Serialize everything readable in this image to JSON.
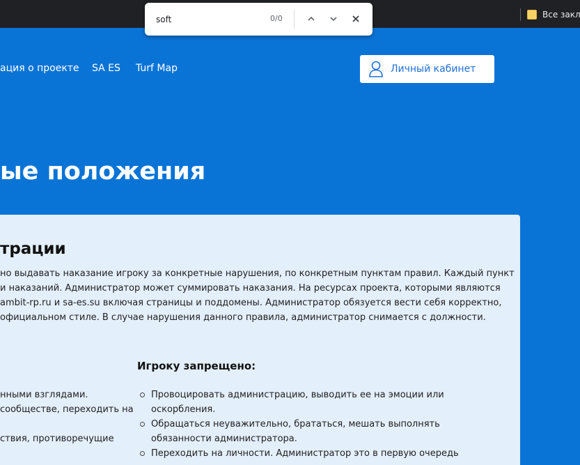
{
  "browser": {
    "bookmarks_label": "Все закла",
    "find": {
      "query": "soft",
      "count": "0/0"
    }
  },
  "nav": {
    "items": [
      "ация о проекте",
      "SA ES",
      "Turf Map"
    ],
    "cabinet_label": "Личный кабинет"
  },
  "hero": {
    "title": "ые положения"
  },
  "section": {
    "title": "трации",
    "intro_lines": [
      "но выдавать наказание игроку за конкретные нарушения, по конкретным пунктам правил. Каждый пункт",
      "и наказаний. Администратор может суммировать наказания. На ресурсах проекта, которыми являются",
      "ambit-rp.ru и sa-es.su включая страницы и поддомены. Администратор обязуется вести себя корректно,",
      "официальном стиле. В случае нарушения данного правила, администратор снимается с должности."
    ],
    "left_lines": [
      "нными взглядами.",
      "сообществе, переходить на",
      "",
      "ствия, противоречущие"
    ],
    "player_forbidden_title": "Игроку запрещено:",
    "rules": [
      [
        "Провоцировать администрацию, выводить ее на эмоции или",
        "оскорбления."
      ],
      [
        "Обращаться неуважительно, брататься, мешать выполнять",
        "обязанности администратора."
      ],
      [
        "Переходить на личности. Администратор это в первую очередь",
        ""
      ]
    ]
  }
}
